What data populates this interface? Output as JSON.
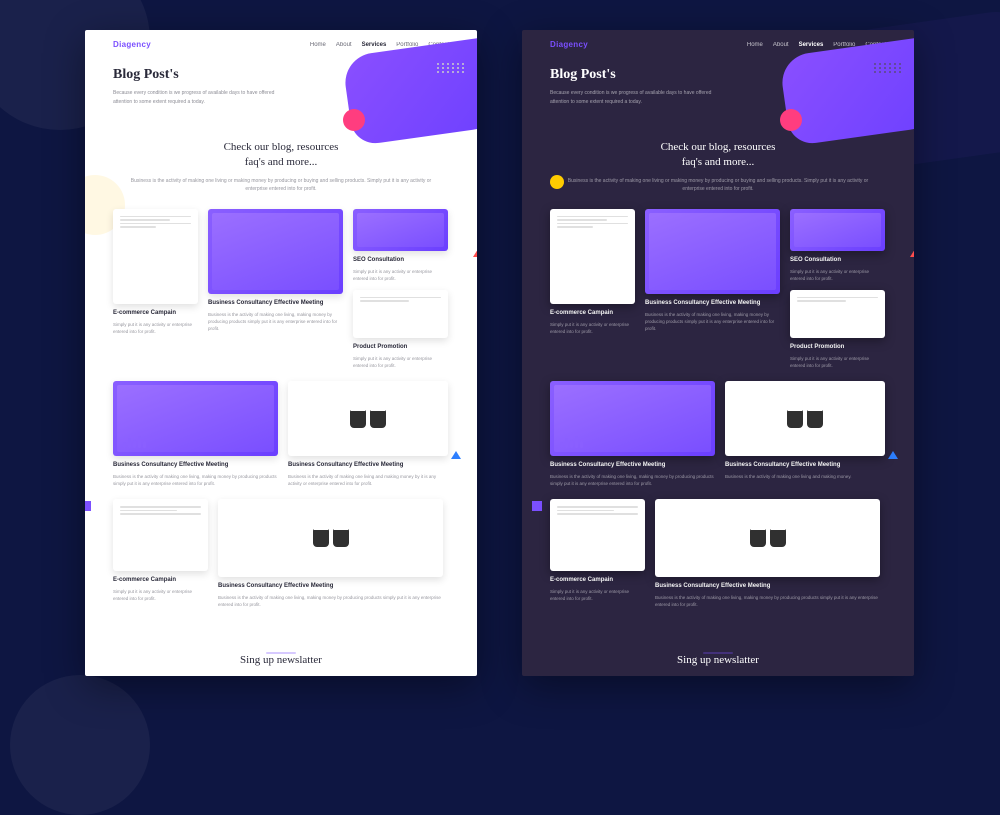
{
  "brand": "Diagency",
  "nav": {
    "items": [
      "Home",
      "About",
      "Services",
      "Portfolio",
      "Contact"
    ],
    "active": "Services"
  },
  "hero": {
    "title": "Blog Post's",
    "subtitle": "Because every condition is we progress of available days to have offered attention to some extent required a today."
  },
  "section": {
    "heading_line1": "Check our blog, resources",
    "heading_line2": "faq's and more...",
    "sub": "Business is the activity of making one living or making money by producing or buying and selling products. Simply put it is any activity or enterprise entered into for profit."
  },
  "posts": [
    {
      "title": "E-commerce Campain",
      "desc": "Simply put it is any activity or enterprise entered into for profit."
    },
    {
      "title": "Business Consultancy Effective Meeting",
      "desc": "Business is the activity of making one living, making money by producing products simply put it is any enterprise entered into for profit."
    },
    {
      "title": "SEO Consultation",
      "desc": "Simply put it is any activity or enterprise entered into for profit."
    },
    {
      "title": "Product Promotion",
      "desc": "Simply put it is any activity or enterprise entered into for profit."
    },
    {
      "title": "Business Consultancy Effective Meeting",
      "desc": "Business is the activity of making one living, making money by producing products simply put it is any enterprise entered into for profit."
    },
    {
      "title": "Business Consultancy Effective Meeting",
      "desc": "Business is the activity of making one living and making money by it is any activity or enterprise entered into for profit."
    },
    {
      "title": "E-commerce Campain",
      "desc": "Simply put it is any activity or enterprise entered into for profit."
    },
    {
      "title": "Business Consultancy Effective Meeting",
      "desc": "Business is the activity of making one living, making money by producing products simply put it is any enterprise entered into for profit."
    }
  ],
  "newsletter": {
    "heading": "Sing up newslatter"
  },
  "dark_posts": [
    {
      "title": "E-commerce Campain",
      "desc": "Simply put it is any activity or enterprise entered into for profit."
    },
    {
      "title": "Business Consultancy Effective Meeting",
      "desc": "Business is the activity of making one living, making money by producing products simply put it is any enterprise entered into for profit."
    },
    {
      "title": "SEO Consultation",
      "desc": "Simply put it is any activity or enterprise entered into for profit."
    },
    {
      "title": "Product Promotion",
      "desc": "Simply put it is any activity or enterprise entered into for profit."
    },
    {
      "title": "Business Consultancy Effective Meeting",
      "desc": "Business is the activity of making one living, making money by producing products simply put it is any enterprise entered into for profit."
    },
    {
      "title": "Business Consultancy Effective Meeting",
      "desc": "Business is the activity of making one living and making money."
    },
    {
      "title": "E-commerce Campain",
      "desc": "Simply put it is any activity or enterprise entered into for profit."
    },
    {
      "title": "Business Consultancy Effective Meeting",
      "desc": "Business is the activity of making one living, making money by producing products simply put it is any enterprise entered into for profit."
    }
  ]
}
